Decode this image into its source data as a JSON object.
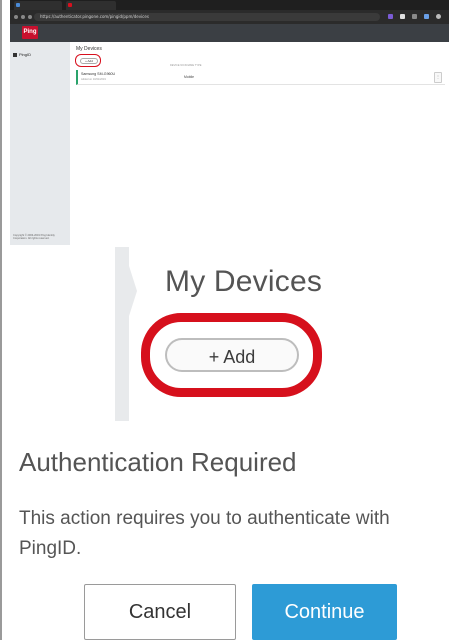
{
  "browser": {
    "tabs": [
      {
        "label": "My Devices - Ping",
        "color": "#4a8ad6"
      },
      {
        "label": "PingOne",
        "color": "#d8101e"
      }
    ],
    "url": "https://authenticator.pingone.com/pingid/ppm/devices",
    "accent": "#c8102e"
  },
  "app": {
    "logo_text": "Ping",
    "sidebar": {
      "items": [
        {
          "label": "PingID",
          "icon": "device-icon"
        }
      ],
      "footer": "Copyright © 2003-2019 Ping Identity Corporation. All rights reserved."
    },
    "main": {
      "title": "My Devices",
      "add_label": "+ Add",
      "column_header": "DEVICE NICKNAME TYPE",
      "devices": [
        {
          "name": "Samsung SM-G960U",
          "sub": "Added on 10/31/2019",
          "type": "Mobile",
          "action_icon": "more-icon"
        }
      ]
    }
  },
  "zoom": {
    "title": "My Devices",
    "add_label": "+ Add",
    "highlight_color": "#d6101c"
  },
  "dialog": {
    "title": "Authentication Required",
    "message": "This action requires you to authenticate with PingID.",
    "cancel_label": "Cancel",
    "continue_label": "Continue",
    "continue_color": "#2d9bd6"
  }
}
